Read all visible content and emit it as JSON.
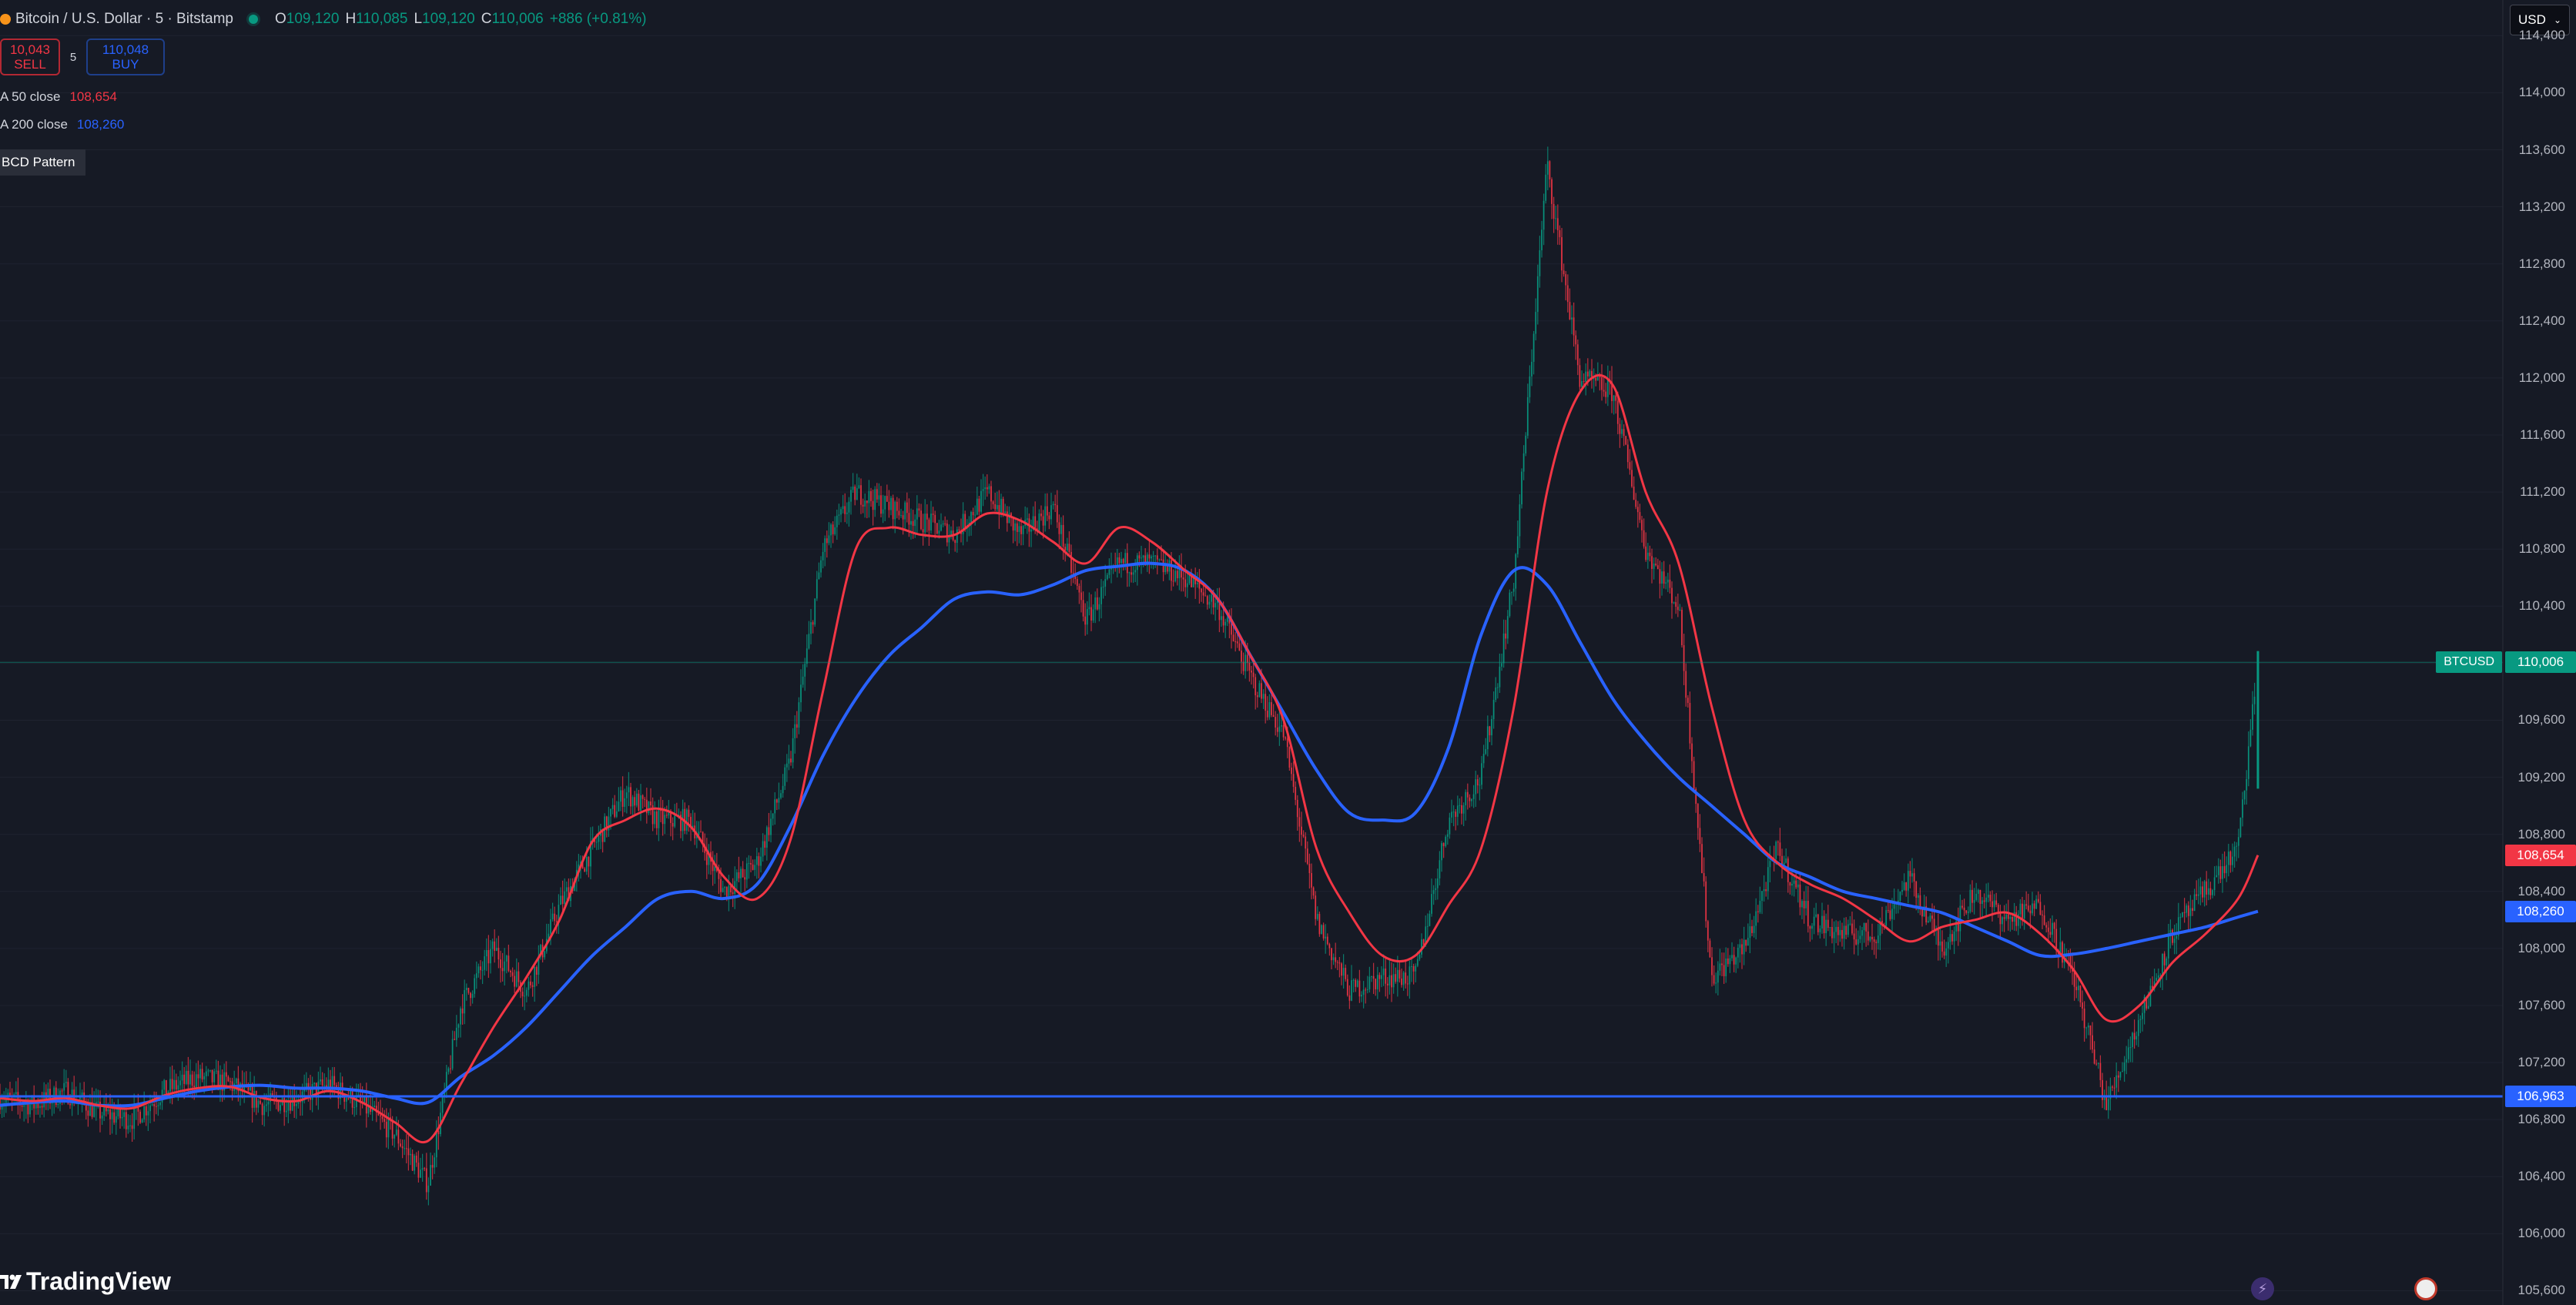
{
  "header": {
    "symbol_title": "Bitcoin / U.S. Dollar · 5 · Bitstamp",
    "o_label": "O",
    "o_value": "109,120",
    "h_label": "H",
    "h_value": "110,085",
    "l_label": "L",
    "l_value": "109,120",
    "c_label": "C",
    "c_value": "110,006",
    "change": "+886 (+0.81%)"
  },
  "trade": {
    "sell_price": "10,043",
    "sell_label": "SELL",
    "spread": "5",
    "buy_price": "110,048",
    "buy_label": "BUY"
  },
  "indicators": {
    "ma50_label": "A 50 close",
    "ma50_value": "108,654",
    "ma200_label": "A 200 close",
    "ma200_value": "108,260"
  },
  "pattern_label": "BCD Pattern",
  "currency": "USD",
  "price_axis": {
    "ticks": [
      "114,400",
      "114,000",
      "113,600",
      "113,200",
      "112,800",
      "112,400",
      "112,000",
      "111,600",
      "111,200",
      "110,800",
      "110,400",
      "110,000",
      "109,600",
      "109,200",
      "108,800",
      "108,400",
      "108,000",
      "107,600",
      "107,200",
      "106,800",
      "106,400",
      "106,000",
      "105,600"
    ],
    "tick_values": [
      114400,
      114000,
      113600,
      113200,
      112800,
      112400,
      112000,
      111600,
      111200,
      110800,
      110400,
      110000,
      109600,
      109200,
      108800,
      108400,
      108000,
      107600,
      107200,
      106800,
      106400,
      106000,
      105600
    ],
    "last_price_symbol": "BTCUSD",
    "last_price_value": "110,006",
    "ma50_tag": "108,654",
    "ma200_tag": "108,260",
    "hline_tag": "106,963"
  },
  "logo_text": "TradingView",
  "colors": {
    "background": "#161a25",
    "up": "#089981",
    "down": "#f23645",
    "ma50": "#f23645",
    "ma200": "#2962ff",
    "hline": "#2962ff",
    "grid": "#1f2330"
  },
  "chart_data": {
    "type": "line",
    "title": "Bitcoin / U.S. Dollar · 5 · Bitstamp",
    "ylim": [
      105500,
      114650
    ],
    "x": [
      0,
      20,
      40,
      60,
      80,
      100,
      120,
      140,
      160,
      180,
      200,
      220,
      240,
      260,
      280,
      300,
      320,
      340,
      360,
      380,
      400,
      420,
      440,
      460,
      480,
      500,
      520,
      540,
      560,
      580,
      600,
      620,
      640,
      660,
      680,
      700,
      720,
      740,
      760,
      780,
      800,
      820,
      840,
      860,
      880,
      900,
      920,
      940,
      960,
      980,
      1000,
      1020,
      1040,
      1060,
      1080,
      1100,
      1120,
      1140,
      1160,
      1180,
      1200,
      1220,
      1240,
      1260,
      1280,
      1300,
      1320,
      1340,
      1360,
      1372
    ],
    "series": [
      {
        "name": "BTCUSD",
        "values": [
          106950,
          106900,
          107000,
          106850,
          106800,
          107000,
          107100,
          107050,
          106900,
          106950,
          107050,
          106900,
          106700,
          106350,
          107600,
          108000,
          107700,
          108300,
          108700,
          109100,
          108900,
          108900,
          108400,
          108600,
          109300,
          110800,
          111200,
          111100,
          111000,
          110900,
          111200,
          110900,
          111100,
          110300,
          110700,
          110700,
          110600,
          110400,
          109900,
          109500,
          108200,
          107700,
          107800,
          107800,
          108900,
          109200,
          110600,
          113500,
          112000,
          111900,
          110800,
          110400,
          107800,
          108000,
          108700,
          108200,
          108100,
          108100,
          108500,
          108000,
          108400,
          108200,
          108300,
          107800,
          106900,
          107500,
          108100,
          108400,
          108700,
          110006
        ]
      },
      {
        "name": "A 50 close",
        "values": [
          106950,
          106930,
          106950,
          106900,
          106880,
          106970,
          107020,
          107030,
          106950,
          106930,
          107000,
          106920,
          106780,
          106650,
          107050,
          107450,
          107800,
          108200,
          108750,
          108900,
          108980,
          108850,
          108500,
          108350,
          108750,
          109800,
          110800,
          110950,
          110900,
          110900,
          111050,
          111000,
          110850,
          110700,
          110950,
          110850,
          110650,
          110450,
          110050,
          109600,
          108700,
          108250,
          107950,
          107950,
          108300,
          108700,
          109700,
          111200,
          111900,
          111950,
          111200,
          110700,
          109700,
          108900,
          108600,
          108450,
          108350,
          108200,
          108050,
          108150,
          108200,
          108250,
          108100,
          107850,
          107500,
          107600,
          107900,
          108100,
          108350,
          108654
        ]
      },
      {
        "name": "A 200 close",
        "values": [
          106900,
          106920,
          106930,
          106900,
          106900,
          106950,
          107000,
          107030,
          107040,
          107020,
          107020,
          107000,
          106950,
          106920,
          107100,
          107250,
          107450,
          107700,
          107950,
          108150,
          108350,
          108400,
          108350,
          108450,
          108850,
          109350,
          109750,
          110050,
          110250,
          110450,
          110500,
          110480,
          110550,
          110650,
          110680,
          110700,
          110650,
          110450,
          110050,
          109650,
          109250,
          108950,
          108900,
          108950,
          109400,
          110200,
          110650,
          110550,
          110150,
          109750,
          109450,
          109200,
          109000,
          108800,
          108600,
          108500,
          108400,
          108350,
          108300,
          108250,
          108150,
          108050,
          107950,
          107960,
          108000,
          108050,
          108100,
          108150,
          108220,
          108260
        ]
      }
    ],
    "hline": 106963,
    "last_price": 110006
  }
}
